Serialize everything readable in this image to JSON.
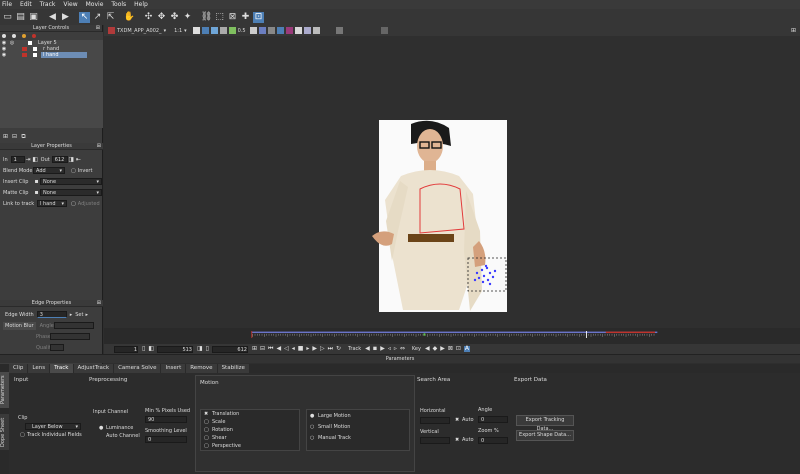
{
  "menu": [
    "File",
    "Edit",
    "Track",
    "View",
    "Movie",
    "Tools",
    "Help"
  ],
  "layer_controls": {
    "title": "Layer Controls",
    "layers": [
      {
        "name": "Layer 5",
        "selected": false
      },
      {
        "name": "r hand",
        "selected": false
      },
      {
        "name": "l hand",
        "selected": true
      }
    ]
  },
  "layer_properties": {
    "title": "Layer Properties",
    "in_label": "In",
    "in_value": "1",
    "out_label": "Out",
    "out_value": "612",
    "blend_label": "Blend Mode",
    "blend_value": "Add",
    "invert_label": "Invert",
    "insert_clip_label": "Insert Clip",
    "insert_clip_value": "None",
    "matte_clip_label": "Matte Clip",
    "matte_clip_value": "None",
    "link_label": "Link to track",
    "link_value": "l hand",
    "adjusted_label": "Adjusted"
  },
  "edge_properties": {
    "title": "Edge Properties",
    "edge_width_label": "Edge Width",
    "edge_width_value": "3",
    "set_label": "Set",
    "motion_blur_label": "Motion Blur",
    "angle_label": "Angle",
    "phase_label": "Phase",
    "quality_label": "Quality"
  },
  "viewer": {
    "clip_name": "TXDM_APP_A002_",
    "zoom": "1:1",
    "opacity": "0.5"
  },
  "timeline": {
    "start": "1",
    "current": "513",
    "end": "612",
    "track_label": "Track",
    "key_label": "Key",
    "playhead_fraction": 0.83,
    "key_fraction": 0.43
  },
  "params": {
    "title": "Parameters",
    "tabs": [
      "Clip",
      "Lens",
      "Track",
      "AdjustTrack",
      "Camera Solve",
      "Insert",
      "Remove",
      "Stabilize"
    ],
    "active_tab": "Track",
    "side_tabs": [
      "Parameters",
      "Dope Sheet"
    ],
    "input": {
      "title": "Input",
      "clip_label": "Clip",
      "clip_value": "Layer Below",
      "track_individual": "Track Individual Fields"
    },
    "preprocessing": {
      "title": "Preprocessing",
      "input_channel_label": "Input Channel",
      "luminance": "Luminance",
      "auto_channel": "Auto Channel",
      "min_pixels_label": "Min % Pixels Used",
      "min_pixels_value": "90",
      "smoothing_label": "Smoothing Level",
      "smoothing_value": "0"
    },
    "motion": {
      "title": "Motion",
      "options": [
        "Translation",
        "Scale",
        "Rotation",
        "Shear",
        "Perspective"
      ],
      "checked": "Translation",
      "sizes": [
        "Large Motion",
        "Small Motion",
        "Manual Track"
      ],
      "selected_size": "Large Motion"
    },
    "search_area": {
      "title": "Search Area",
      "horizontal": "Horizontal",
      "vertical": "Vertical",
      "auto": "Auto",
      "angle_label": "Angle",
      "angle_value": "0",
      "zoom_label": "Zoom %",
      "zoom_value": "0"
    },
    "export": {
      "title": "Export Data",
      "tracking": "Export Tracking Data...",
      "shape": "Export Shape Data..."
    }
  },
  "colors": {
    "selection": "#4d7fb5",
    "track_red": "#c0332b",
    "timeline_blue": "#6a74c9"
  }
}
